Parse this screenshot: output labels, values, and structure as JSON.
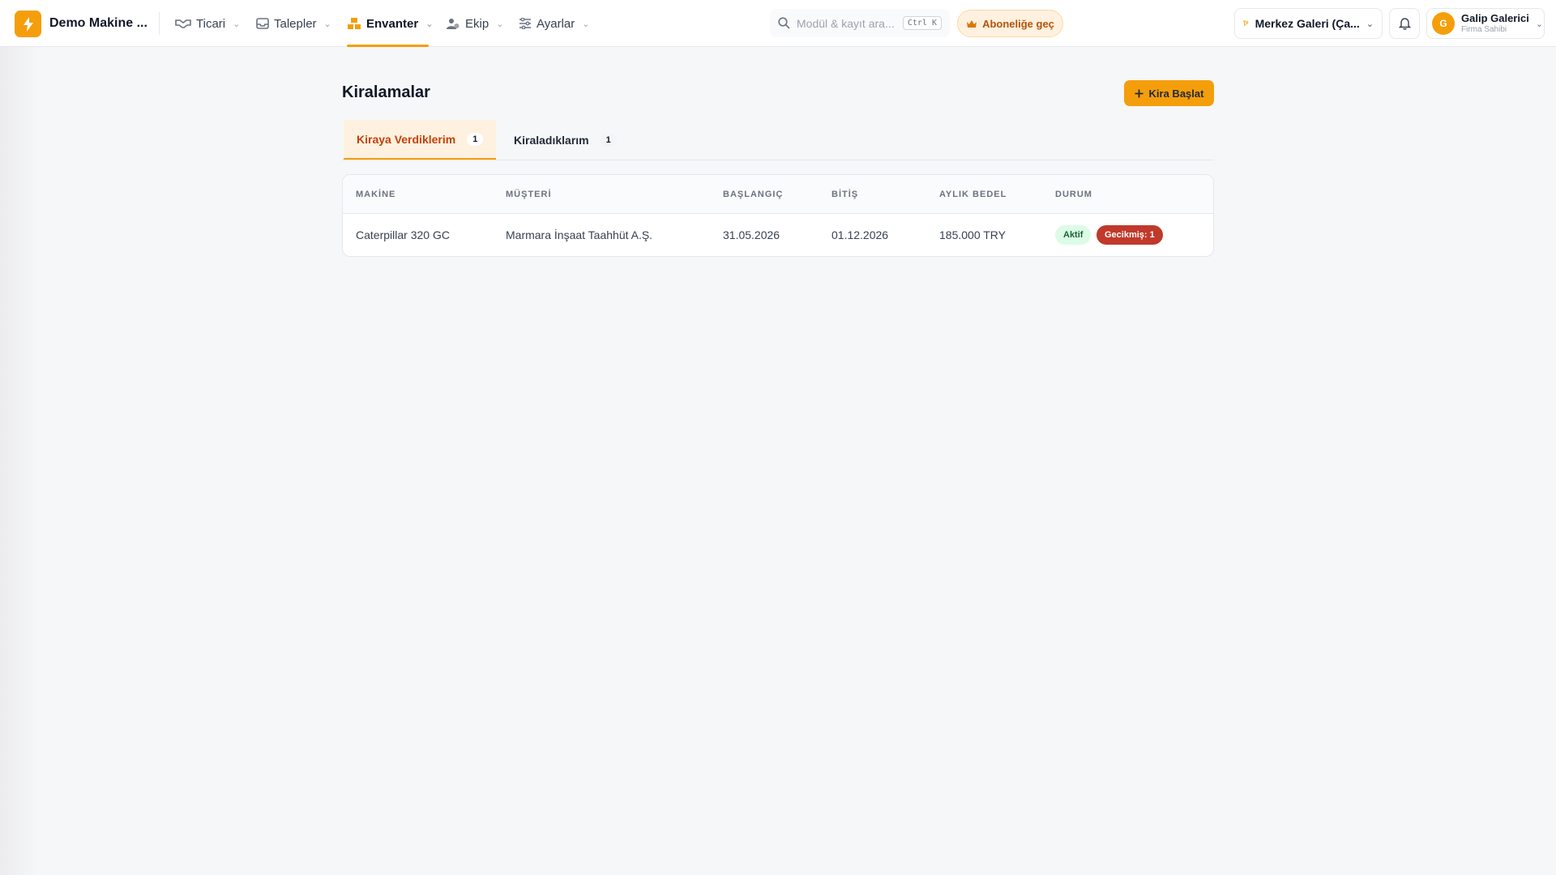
{
  "app": {
    "brand": "Demo Makine ...",
    "colors": {
      "accent": "#f59e0b",
      "active_badge": "#dcfce7",
      "late_badge": "#c0392b"
    }
  },
  "nav": [
    {
      "label": "Ticari",
      "icon": "handshake-icon"
    },
    {
      "label": "Talepler",
      "icon": "inbox-icon"
    },
    {
      "label": "Envanter",
      "icon": "boxes-icon",
      "active": true
    },
    {
      "label": "Ekip",
      "icon": "users-icon"
    },
    {
      "label": "Ayarlar",
      "icon": "sliders-icon"
    }
  ],
  "search": {
    "placeholder": "Modül & kayıt ara...",
    "shortcut": "Ctrl K"
  },
  "subscribe": {
    "label": "Aboneliğe geç",
    "icon": "crown-icon"
  },
  "branch": {
    "label": "Merkez Galeri (Ça...",
    "icon": "branch-icon"
  },
  "user": {
    "initial": "G",
    "name": "Galip Galerici",
    "role": "Firma Sahibi"
  },
  "page": {
    "title": "Kiralamalar",
    "primary_action": "Kira Başlat"
  },
  "tabs": [
    {
      "label": "Kiraya Verdiklerim",
      "count": "1",
      "active": true
    },
    {
      "label": "Kiraladıklarım",
      "count": "1"
    }
  ],
  "table": {
    "headers": [
      "MAKİNE",
      "MÜŞTERİ",
      "BAŞLANGIÇ",
      "BİTİŞ",
      "AYLIK BEDEL",
      "DURUM"
    ],
    "rows": [
      {
        "machine": "Caterpillar 320 GC",
        "customer": "Marmara İnşaat Taahhüt A.Ş.",
        "start": "31.05.2026",
        "end": "01.12.2026",
        "monthly_fee": "185.000 TRY",
        "status": "Aktif",
        "overdue": "Gecikmiş: 1"
      }
    ]
  }
}
